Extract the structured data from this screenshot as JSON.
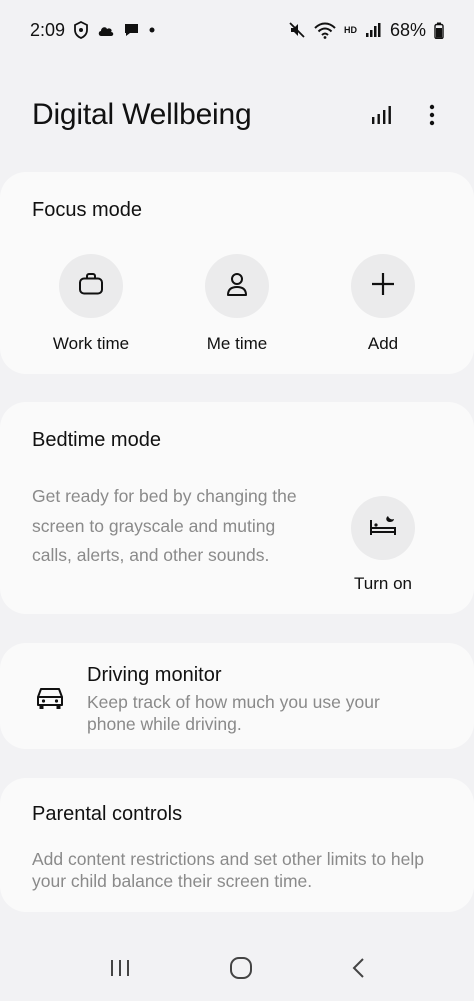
{
  "status_bar": {
    "time": "2:09",
    "hd_label": "HD",
    "battery": "68%",
    "left_icons": [
      "vpn-shield-icon",
      "cloud-icon",
      "chat-bubble-icon",
      "dot-icon"
    ],
    "right_icons": [
      "mute-icon",
      "wifi-icon",
      "signal-icon",
      "battery-icon"
    ]
  },
  "header": {
    "title": "Digital Wellbeing",
    "actions": [
      "bar-chart-icon",
      "more-vert-icon"
    ]
  },
  "focus_mode": {
    "title": "Focus mode",
    "options": [
      {
        "label": "Work time",
        "icon": "briefcase-icon"
      },
      {
        "label": "Me time",
        "icon": "person-icon"
      },
      {
        "label": "Add",
        "icon": "plus-icon"
      }
    ]
  },
  "bedtime_mode": {
    "title": "Bedtime mode",
    "description": "Get ready for bed by changing the screen to grayscale and muting calls, alerts, and other sounds.",
    "action_label": "Turn on",
    "action_icon": "bed-icon"
  },
  "driving_monitor": {
    "title": "Driving monitor",
    "description": "Keep track of how much you use your phone while driving.",
    "icon": "car-icon"
  },
  "parental_controls": {
    "title": "Parental controls",
    "description": "Add content restrictions and set other limits to help your child balance their screen time."
  },
  "nav_bar": {
    "items": [
      "recents-icon",
      "home-icon",
      "back-icon"
    ]
  },
  "colors": {
    "background": "#f2f2f4",
    "card": "#fafafa",
    "icon_circle": "#ebebec",
    "secondary_text": "#8a8a8a"
  }
}
